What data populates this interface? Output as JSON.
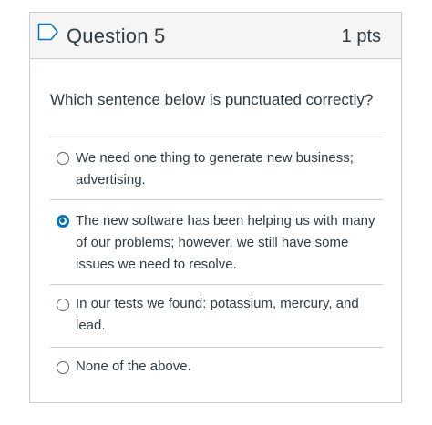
{
  "question": {
    "title": "Question 5",
    "points": "1 pts",
    "prompt": "Which sentence below is punctuated correctly?"
  },
  "answers": [
    {
      "lines": [
        "We need one thing to generate new business;",
        "advertising."
      ],
      "selected": false
    },
    {
      "lines": [
        "The new software has been helping us with many",
        "of our problems; however, we still have some",
        "issues we need to resolve."
      ],
      "selected": true
    },
    {
      "lines": [
        "In our tests we found: potassium, mercury, and",
        "lead."
      ],
      "selected": false
    },
    {
      "lines": [
        "None of the above."
      ],
      "selected": false
    }
  ],
  "colors": {
    "accent": "#0374b5",
    "text": "#2d3b45",
    "border": "#c7cdd1",
    "header_bg": "#f5f5f5"
  },
  "icons": {
    "flag": "flag-question-icon"
  }
}
